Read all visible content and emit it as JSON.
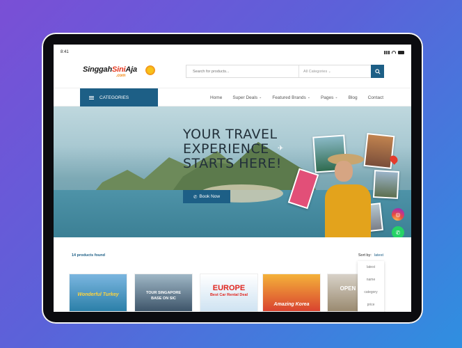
{
  "status": {
    "time": "8:41"
  },
  "brand": {
    "name_dark": "Singgah",
    "name_accent": "Sini",
    "name_dark2": "Aja",
    "suffix": ".com"
  },
  "search": {
    "placeholder": "Search for products...",
    "category": "All Categories"
  },
  "categories_button": "CATEGORIES",
  "nav": [
    {
      "label": "Home"
    },
    {
      "label": "Super Deals"
    },
    {
      "label": "Featured Brands"
    },
    {
      "label": "Pages"
    },
    {
      "label": "Blog"
    },
    {
      "label": "Contact"
    }
  ],
  "hero": {
    "headline_1": "YOUR TRAVEL",
    "headline_2": "EXPERIENCE",
    "headline_3": "STARTS HERE!",
    "button": "Book Now"
  },
  "listing": {
    "count": "14",
    "count_label": "products found",
    "sort_label": "Sort by:",
    "sort_value": "latest",
    "sort_options": [
      "latest",
      "name",
      "category",
      "price"
    ]
  },
  "products": [
    {
      "title": "Wonderful Turkey"
    },
    {
      "title": "TOUR SINGAPORE",
      "subtitle": "BASE ON SIC"
    },
    {
      "title": "EUROPE",
      "subtitle": "Best Car Rental Deal"
    },
    {
      "title": "Amazing Korea"
    },
    {
      "title": "OPEN"
    }
  ],
  "colors": {
    "primary": "#1d5f86",
    "accent": "#e4381f",
    "whatsapp": "#25d366"
  }
}
